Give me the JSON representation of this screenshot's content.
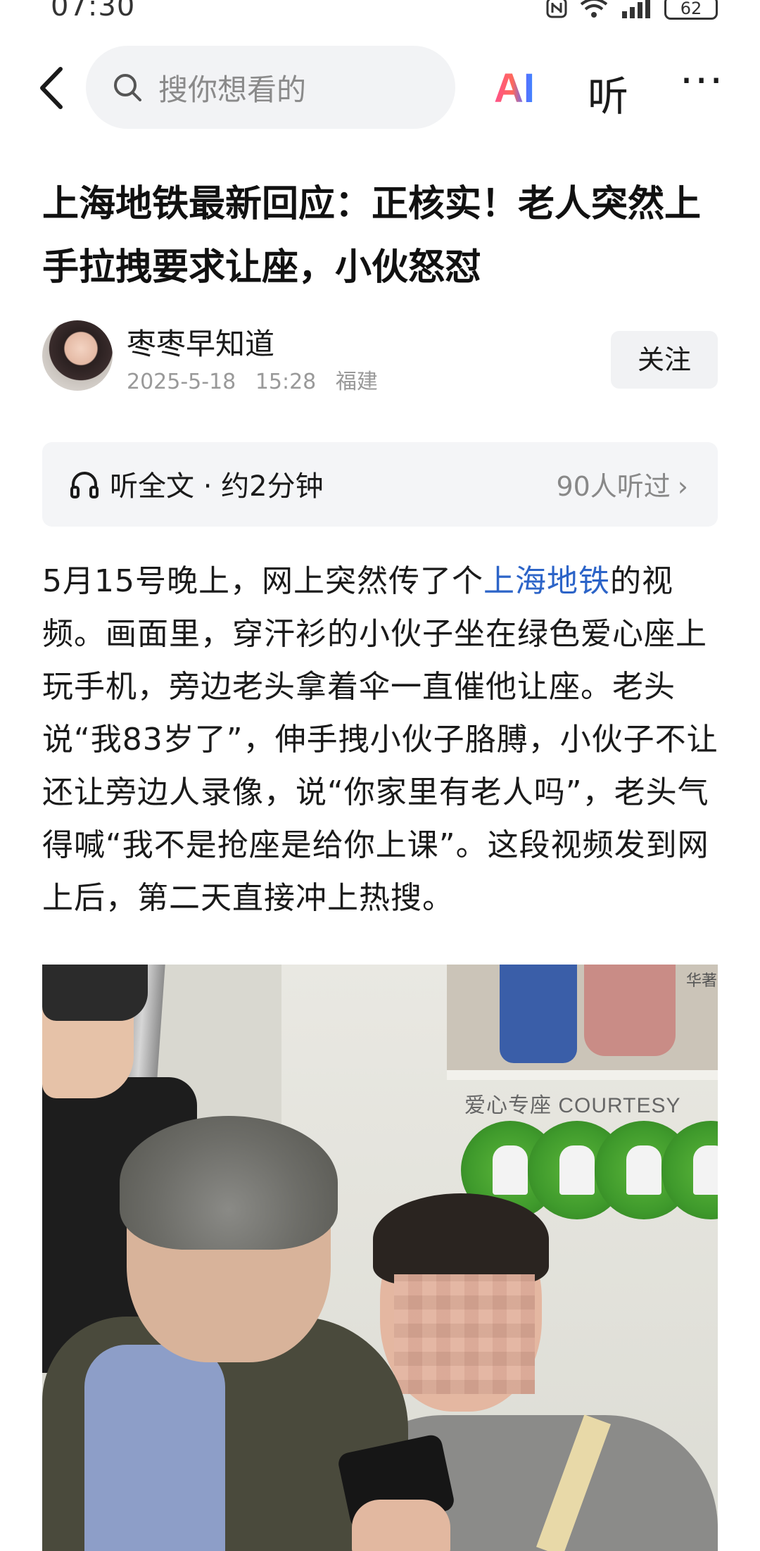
{
  "status_bar": {
    "time": "07:30",
    "battery": "62"
  },
  "topbar": {
    "search_placeholder": "搜你想看的",
    "ai_label": "AI",
    "listen_label": "听",
    "more_label": "···"
  },
  "article": {
    "title": "上海地铁最新回应：正核实！老人突然上手拉拽要求让座，小伙怒怼",
    "author": {
      "name": "枣枣早知道",
      "date": "2025-5-18",
      "time": "15:28",
      "location": "福建",
      "follow_label": "关注"
    },
    "listen_bar": {
      "label": "听全文 · 约2分钟",
      "count": "90人听过",
      "chevron": "›"
    },
    "body": {
      "part1": "5月15号晚上，网上突然传了个",
      "link": "上海地铁",
      "part2": "的视频。画面里，穿汗衫的小伙子坐在绿色爱心座上玩手机，旁边老头拿着伞一直催他让座。老头说“我83岁了”，伸手拽小伙子胳膊，小伙子不让还让旁边人录像，说“你家里有老人吗”，老头气得喊“我不是抢座是给你上课”。这段视频发到网上后，第二天直接冲上热搜。"
    },
    "photo": {
      "sign_text": "爱心专座  COURTESY",
      "ad_text": "华著"
    }
  },
  "colors": {
    "link": "#2c64c8",
    "search_bg": "#f2f3f5",
    "listen_bar_bg": "#f4f5f7",
    "sign_green": "#3f9a2c"
  }
}
